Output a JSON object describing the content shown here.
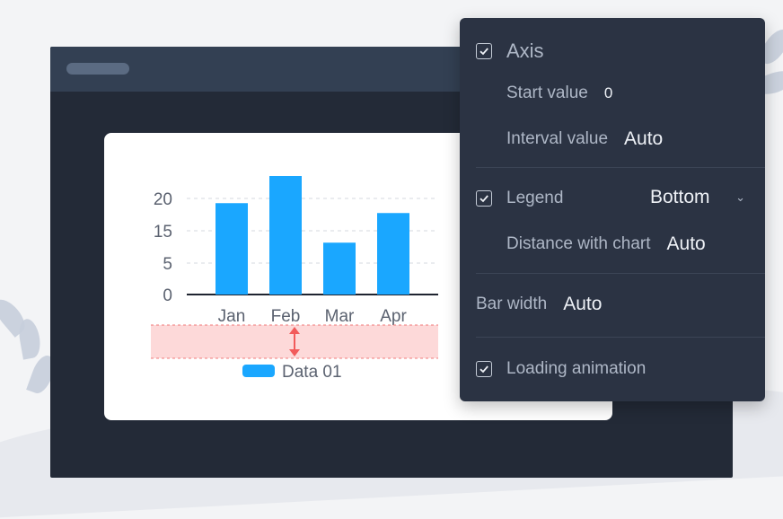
{
  "chart": {
    "legend_label": "Data 01"
  },
  "chart_data": {
    "type": "bar",
    "categories": [
      "Jan",
      "Feb",
      "Mar",
      "Apr"
    ],
    "series": [
      {
        "name": "Data 01",
        "values": [
          18.5,
          24,
          10.5,
          16.5
        ]
      }
    ],
    "y_ticks": [
      0,
      5,
      15,
      20
    ],
    "ylim": [
      0,
      26
    ],
    "grid": true,
    "legend": "bottom",
    "color": "#1aa7ff"
  },
  "panel": {
    "axis_label": "Axis",
    "start_value_label": "Start value",
    "start_value": "0",
    "interval_value_label": "Interval value",
    "interval_value": "Auto",
    "legend_label": "Legend",
    "legend_position": "Bottom",
    "distance_label": "Distance with chart",
    "distance_value": "Auto",
    "bar_width_label": "Bar width",
    "bar_width_value": "Auto",
    "loading_animation_label": "Loading animation"
  },
  "colors": {
    "bar": "#1aa7ff",
    "panel_bg": "#2b3343",
    "highlight_band": "#fdd9d9",
    "arrow": "#f25a5a"
  }
}
